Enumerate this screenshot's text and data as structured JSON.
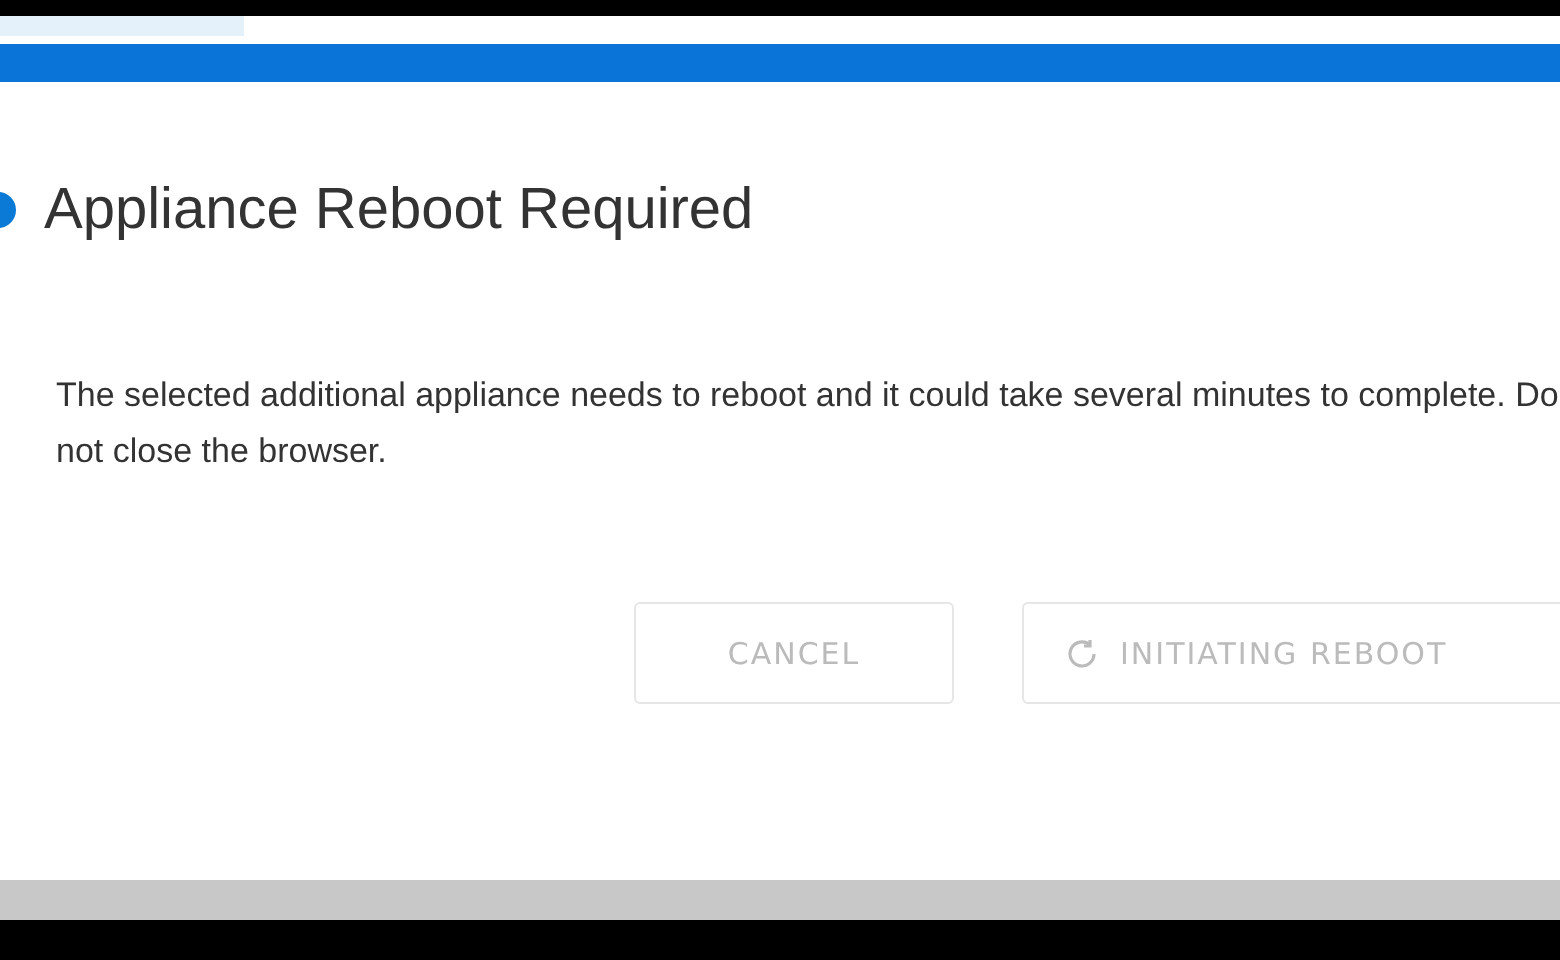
{
  "dialog": {
    "title": "Appliance Reboot Required",
    "message": "The selected additional appliance needs to reboot and it could take several minutes to complete. Do not close the browser.",
    "buttons": [
      {
        "label": "CANCEL",
        "kind": "plain",
        "disabled": true
      },
      {
        "label": "INITIATING REBOOT",
        "kind": "spinner",
        "disabled": true
      }
    ]
  }
}
